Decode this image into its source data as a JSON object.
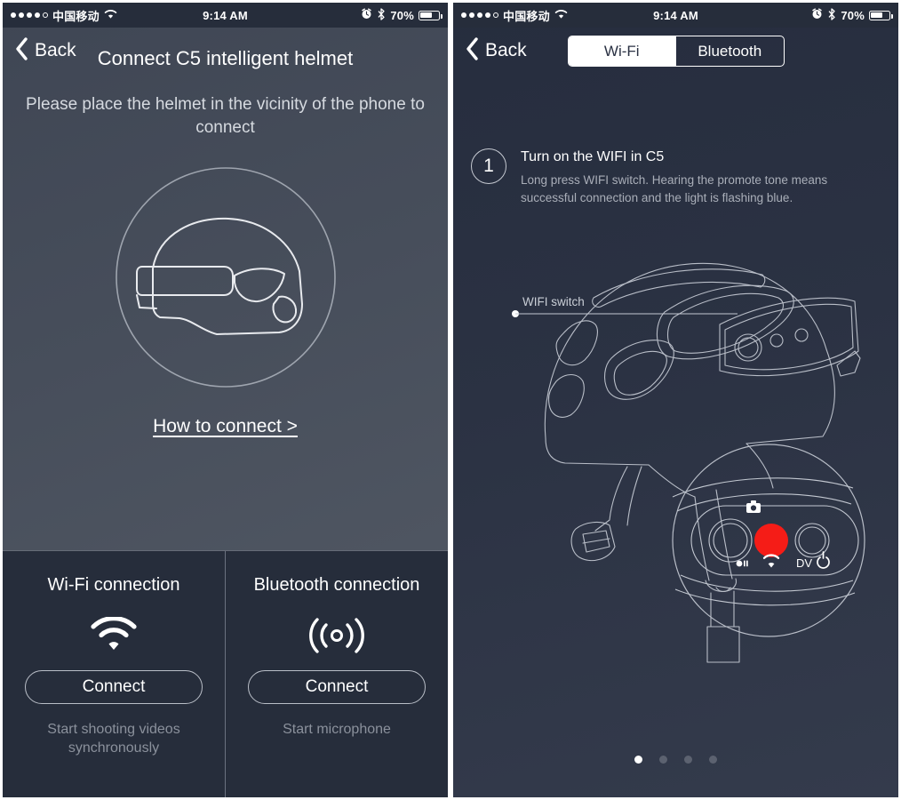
{
  "statusbar": {
    "carrier": "中国移动",
    "time": "9:14 AM",
    "battery_pct": "70%",
    "signal_dots_filled": 4,
    "signal_dots_total": 5,
    "icons": [
      "wifi-icon",
      "alarm-icon",
      "bluetooth-icon",
      "battery-icon"
    ]
  },
  "left": {
    "back_label": "Back",
    "title": "Connect C5 intelligent helmet",
    "subtitle": "Please place the helmet in the vicinity of the phone to connect",
    "how_to_connect": "How to connect >",
    "cards": [
      {
        "title": "Wi-Fi connection",
        "icon": "wifi-icon",
        "button": "Connect",
        "note": "Start shooting videos synchronously"
      },
      {
        "title": "Bluetooth connection",
        "icon": "broadcast-icon",
        "button": "Connect",
        "note": "Start microphone"
      }
    ]
  },
  "right": {
    "back_label": "Back",
    "segments": [
      {
        "label": "Wi-Fi",
        "active": true
      },
      {
        "label": "Bluetooth",
        "active": false
      }
    ],
    "step": {
      "number": "1",
      "title": "Turn on the WIFI in C5",
      "desc": "Long press WIFI switch. Hearing the promote tone means successful connection and the light is flashing blue."
    },
    "callout_label": "WIFI switch",
    "control_labels": {
      "camera": "camera-icon",
      "record": "●/II",
      "wifi": "wifi-icon",
      "dv": "DV",
      "power": "power-icon"
    },
    "pager": {
      "total": 4,
      "active_index": 0
    },
    "accent_red": "#f51c17"
  }
}
